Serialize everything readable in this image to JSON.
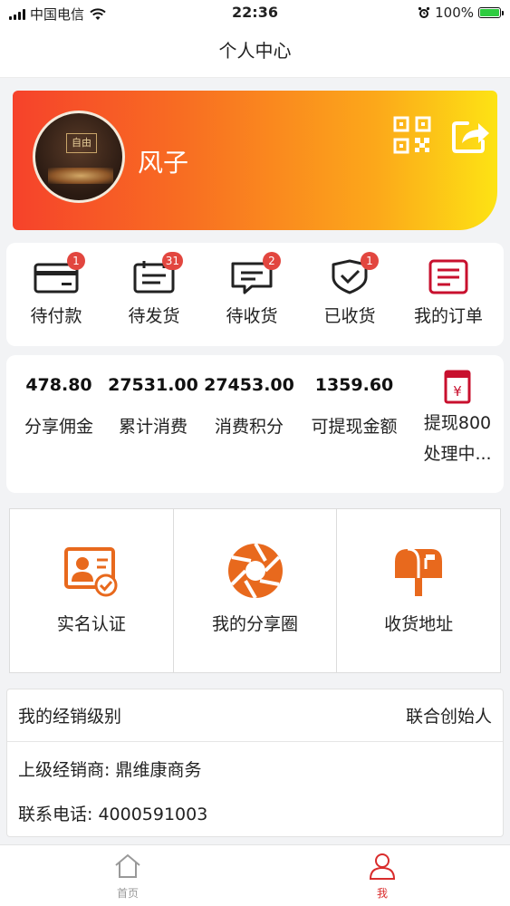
{
  "status_bar": {
    "carrier": "中国电信",
    "time": "22:36",
    "battery": "100%"
  },
  "nav": {
    "title": "个人中心"
  },
  "profile": {
    "username": "风子",
    "avatar_sign_text": "自由"
  },
  "orders": [
    {
      "label": "待付款",
      "badge": "1",
      "icon": "card-icon"
    },
    {
      "label": "待发货",
      "badge": "31",
      "icon": "calendar-icon"
    },
    {
      "label": "待收货",
      "badge": "2",
      "icon": "message-icon"
    },
    {
      "label": "已收货",
      "badge": "1",
      "icon": "shield-check-icon"
    },
    {
      "label": "我的订单",
      "badge": "",
      "icon": "order-list-icon"
    }
  ],
  "stats": [
    {
      "value": "478.80",
      "label": "分享佣金"
    },
    {
      "value": "27531.00",
      "label": "累计消费"
    },
    {
      "value": "27453.00",
      "label": "消费积分"
    },
    {
      "value": "1359.60",
      "label": "可提现金额"
    }
  ],
  "withdraw": {
    "line1": "提现800",
    "line2": "处理中..."
  },
  "features": [
    {
      "label": "实名认证",
      "icon": "id-card-icon"
    },
    {
      "label": "我的分享圈",
      "icon": "aperture-icon"
    },
    {
      "label": "收货地址",
      "icon": "mailbox-icon"
    }
  ],
  "dealer": {
    "level_label": "我的经销级别",
    "level_value": "联合创始人",
    "superior": "上级经销商: 鼎维康商务",
    "phone": "联系电话: 4000591003"
  },
  "tabbar": [
    {
      "label": "首页",
      "active": false
    },
    {
      "label": "我",
      "active": true
    }
  ],
  "colors": {
    "accent": "#e2463f",
    "orange": "#e8691d",
    "tab_active": "#d92c2c",
    "tab_inactive": "#999999"
  }
}
